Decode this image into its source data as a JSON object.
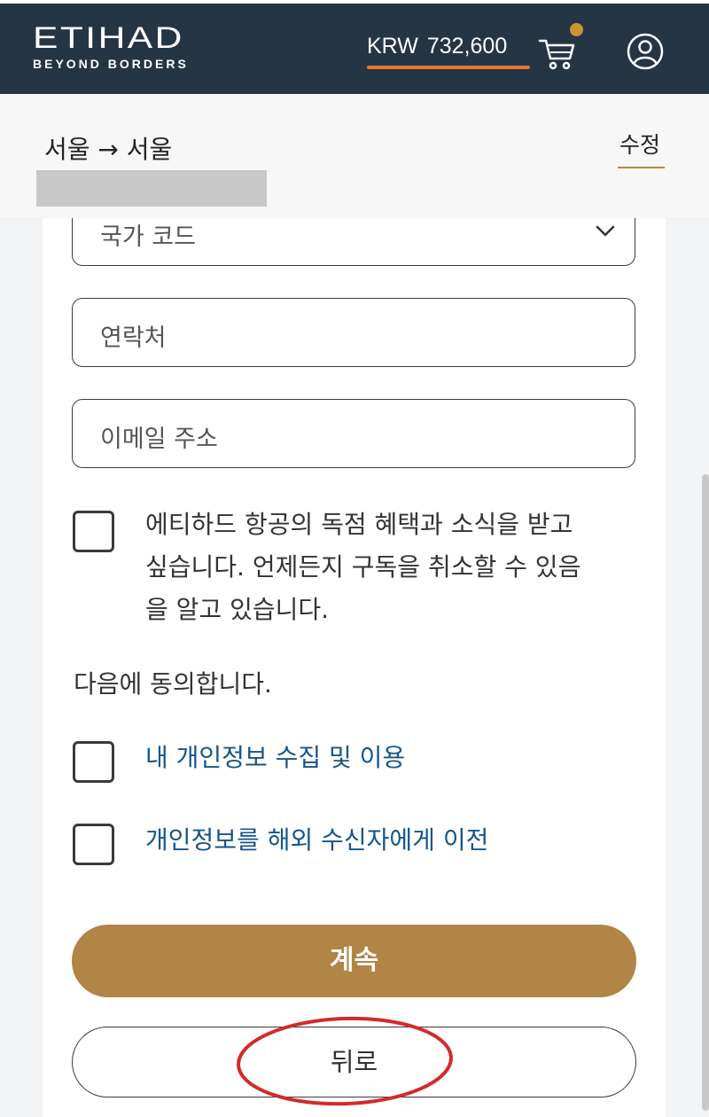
{
  "header": {
    "logo_main": "ETIHAD",
    "logo_sub": "BEYOND BORDERS",
    "currency": "KRW",
    "amount": "732,600",
    "colors": {
      "background": "#243545",
      "accent": "#e8752b",
      "cart_badge": "#c9962e"
    }
  },
  "trip": {
    "route": "서울 → 서울",
    "edit_label": "수정"
  },
  "form": {
    "country_code_placeholder": "국가 코드",
    "contact_placeholder": "연락처",
    "email_placeholder": "이메일 주소",
    "newsletter_label_1": "에티하드 항공의 독점 혜택과 소식을 받고",
    "newsletter_label_2": "싶습니다. 언제든지 구독을 취소할 수 있음",
    "newsletter_label_3": "을 알고 있습니다.",
    "agree_heading": "다음에 동의합니다.",
    "consent_privacy": "내 개인정보 수집 및 이용",
    "consent_transfer": "개인정보를 해외 수신자에게 이전"
  },
  "actions": {
    "continue_label": "계속",
    "back_label": "뒤로",
    "continue_color": "#b08545"
  }
}
